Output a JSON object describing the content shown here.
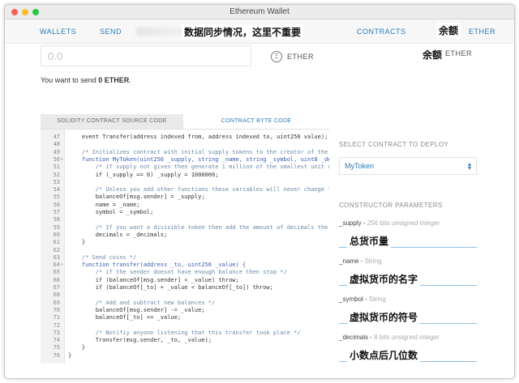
{
  "window": {
    "title": "Ethereum Wallet"
  },
  "nav": {
    "wallets": "WALLETS",
    "send": "SEND",
    "contracts": "CONTRACTS",
    "ether": "ETHER",
    "annotation_sync": "数据同步情况，这里不重要",
    "annotation_balance": "余额"
  },
  "send": {
    "amount_placeholder": "0.0",
    "eth_icon": "Ξ",
    "eth_label": "ETHER",
    "balance_annotation": "余额",
    "balance_unit": "ETHER",
    "note_prefix": "You want to send ",
    "note_amount": "0 ETHER",
    "note_suffix": "."
  },
  "tabs": {
    "source": "SOLIDITY CONTRACT SOURCE CODE",
    "bytecode": "CONTRACT BYTE CODE"
  },
  "code_lines": [
    {
      "n": "47",
      "text": "    event Transfer(address indexed from, address indexed to, uint256 value);",
      "kind": "code",
      "fold": false
    },
    {
      "n": "48",
      "text": "",
      "kind": "code",
      "fold": false
    },
    {
      "n": "49",
      "text": "    /* Initializes contract with initial supply tokens to the creator of the",
      "kind": "comment",
      "fold": false
    },
    {
      "n": "50",
      "text": "    function MyToken(uint256 _supply, string _name, string _symbol, uint8 _de",
      "kind": "keyword",
      "fold": true
    },
    {
      "n": "51",
      "text": "        /* if supply not given then generate 1 million of the smallest unit o",
      "kind": "comment",
      "fold": false
    },
    {
      "n": "52",
      "text": "        if (_supply == 0) _supply = 1000000;",
      "kind": "code",
      "fold": false
    },
    {
      "n": "53",
      "text": "",
      "kind": "code",
      "fold": false
    },
    {
      "n": "54",
      "text": "        /* Unless you add other functions these variables will never change *",
      "kind": "comment",
      "fold": false
    },
    {
      "n": "55",
      "text": "        balanceOf[msg.sender] = _supply;",
      "kind": "code",
      "fold": false
    },
    {
      "n": "56",
      "text": "        name = _name;",
      "kind": "code",
      "fold": false
    },
    {
      "n": "57",
      "text": "        symbol = _symbol;",
      "kind": "code",
      "fold": false
    },
    {
      "n": "58",
      "text": "",
      "kind": "code",
      "fold": false
    },
    {
      "n": "59",
      "text": "        /* If you want a divisible token then add the amount of decimals the",
      "kind": "comment",
      "fold": false
    },
    {
      "n": "60",
      "text": "        decimals = _decimals;",
      "kind": "code",
      "fold": false
    },
    {
      "n": "61",
      "text": "    }",
      "kind": "code",
      "fold": false
    },
    {
      "n": "62",
      "text": "",
      "kind": "code",
      "fold": false
    },
    {
      "n": "63",
      "text": "    /* Send coins */",
      "kind": "comment",
      "fold": false
    },
    {
      "n": "64",
      "text": "    function transfer(address _to, uint256 _value) {",
      "kind": "keyword",
      "fold": true
    },
    {
      "n": "65",
      "text": "        /* if the sender doesnt have enough balance then stop */",
      "kind": "comment",
      "fold": false
    },
    {
      "n": "66",
      "text": "        if (balanceOf[msg.sender] < _value) throw;",
      "kind": "code",
      "fold": false
    },
    {
      "n": "67",
      "text": "        if (balanceOf[_to] + _value < balanceOf[_to]) throw;",
      "kind": "code",
      "fold": false
    },
    {
      "n": "68",
      "text": "",
      "kind": "code",
      "fold": false
    },
    {
      "n": "69",
      "text": "        /* Add and subtract new balances */",
      "kind": "comment",
      "fold": false
    },
    {
      "n": "70",
      "text": "        balanceOf[msg.sender] -= _value;",
      "kind": "code",
      "fold": false
    },
    {
      "n": "71",
      "text": "        balanceOf[_to] += _value;",
      "kind": "code",
      "fold": false
    },
    {
      "n": "72",
      "text": "",
      "kind": "code",
      "fold": false
    },
    {
      "n": "73",
      "text": "        /* Notifiy anyone listening that this transfer took place */",
      "kind": "comment",
      "fold": false
    },
    {
      "n": "74",
      "text": "        Transfer(msg.sender, _to, _value);",
      "kind": "code",
      "fold": false
    },
    {
      "n": "75",
      "text": "    }",
      "kind": "code",
      "fold": false
    },
    {
      "n": "76",
      "text": "}",
      "kind": "code",
      "fold": false
    }
  ],
  "deploy": {
    "select_heading": "SELECT CONTRACT TO DEPLOY",
    "selected_contract": "MyToken",
    "params_heading": "CONSTRUCTOR PARAMETERS",
    "params": [
      {
        "name": "_supply",
        "type": "256 bits unsigned integer",
        "annotation": "总货币量"
      },
      {
        "name": "_name",
        "type": "String",
        "annotation": "虚拟货币的名字"
      },
      {
        "name": "_symbol",
        "type": "String",
        "annotation": "虚拟货币的符号"
      },
      {
        "name": "_decimals",
        "type": "8 bits unsigned integer",
        "annotation": "小数点后几位数"
      }
    ]
  },
  "colors": {
    "accent": "#2b7bb9",
    "comment": "#6a8aa8",
    "keyword": "#3a5bb5"
  }
}
